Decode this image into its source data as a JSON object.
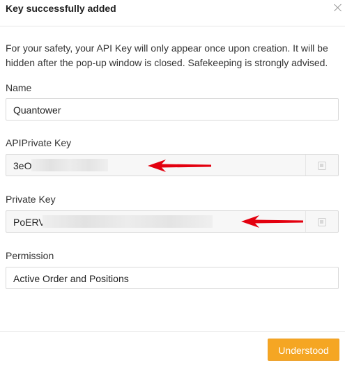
{
  "dialog": {
    "title": "Key successfully added",
    "notice": "For your safety, your API Key will only appear once upon creation. It will be hidden after the pop-up window is closed. Safekeeping is strongly advised."
  },
  "fields": {
    "name": {
      "label": "Name",
      "value": "Quantower"
    },
    "api_key": {
      "label": "APIPrivate Key",
      "value": "3eOl"
    },
    "private_key": {
      "label": "Private Key",
      "value": "PoERV"
    },
    "permission": {
      "label": "Permission",
      "value": "Active Order and Positions"
    }
  },
  "footer": {
    "confirm_label": "Understood"
  },
  "colors": {
    "accent": "#f5a623",
    "arrow": "#e3000f"
  },
  "icons": [
    "close-icon",
    "copy-icon",
    "arrow-annotation"
  ]
}
